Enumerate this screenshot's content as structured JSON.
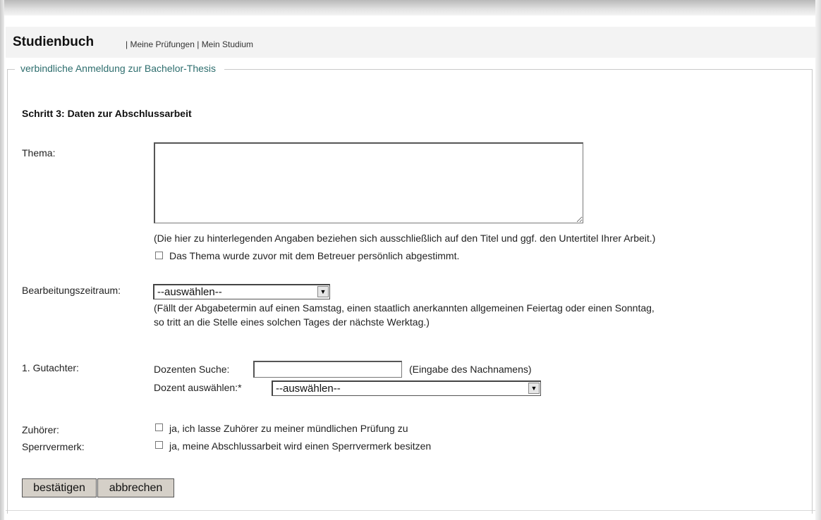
{
  "header": {
    "title": "Studienbuch",
    "nav_sep1": "|",
    "nav_items": [
      "Meine Prüfungen",
      "Mein Studium"
    ],
    "nav_sep2": "|"
  },
  "form": {
    "legend": "verbindliche Anmeldung zur Bachelor-Thesis",
    "step_title": "Schritt 3: Daten zur Abschlussarbeit",
    "thema": {
      "label": "Thema:",
      "value": "",
      "note": "(Die hier zu hinterlegenden Angaben beziehen sich ausschließlich auf den Titel und ggf. den Untertitel Ihrer Arbeit.)",
      "checkbox_label": "Das Thema wurde zuvor mit dem Betreuer persönlich abgestimmt.",
      "checked": false
    },
    "zeitraum": {
      "label": "Bearbeitungszeitraum:",
      "selected": "--auswählen--",
      "note_line1": "(Fällt der Abgabetermin auf einen Samstag, einen staatlich anerkannten allgemeinen Feiertag oder einen Sonntag,",
      "note_line2": "so tritt an die Stelle eines solchen Tages der nächste Werktag.)"
    },
    "gutachter": {
      "label": "1. Gutachter:",
      "search_label": "Dozenten Suche:",
      "search_value": "",
      "search_hint": "(Eingabe des Nachnamens)",
      "select_label": "Dozent auswählen:*",
      "selected": "--auswählen--"
    },
    "zuhoerer": {
      "label": "Zuhörer:",
      "checkbox_label": "ja, ich lasse Zuhörer zu meiner mündlichen Prüfung zu",
      "checked": false
    },
    "sperrvermerk": {
      "label": "Sperrvermerk:",
      "checkbox_label": "ja, meine Abschlussarbeit wird einen Sperrvermerk besitzen",
      "checked": false
    },
    "buttons": {
      "confirm": "bestätigen",
      "cancel": "abbrechen"
    }
  }
}
